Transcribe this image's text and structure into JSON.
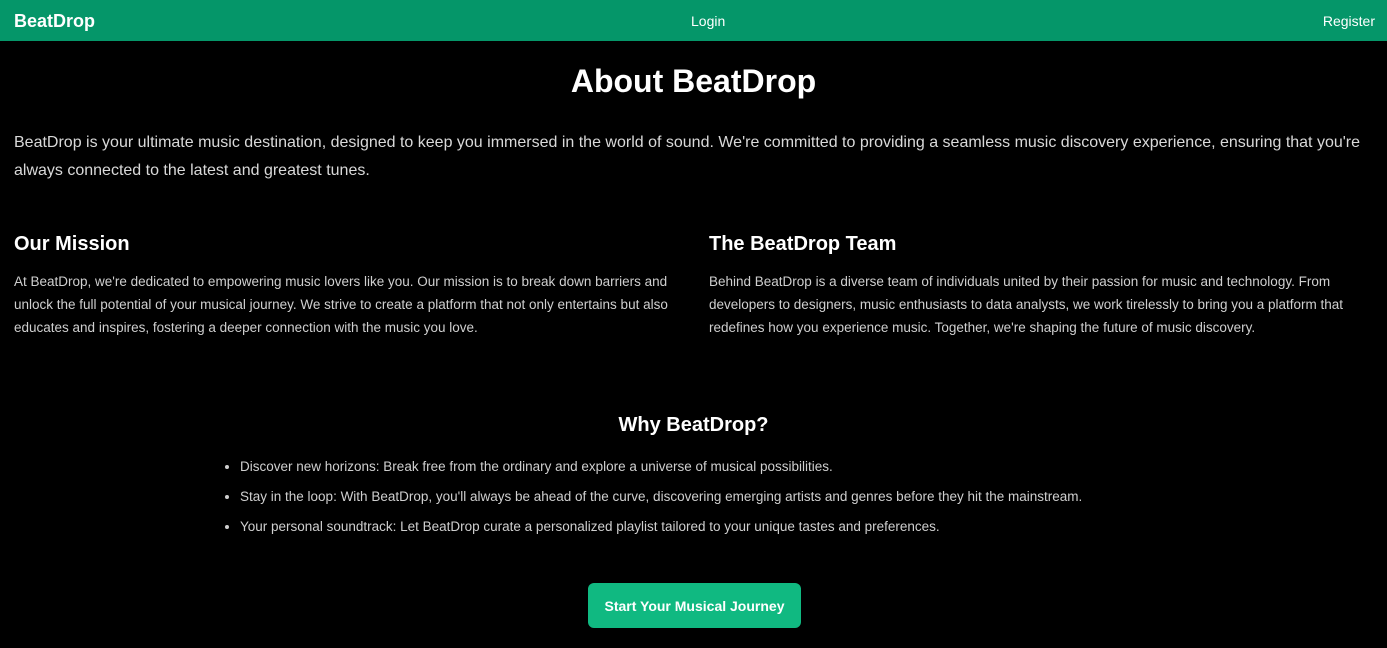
{
  "navbar": {
    "brand": "BeatDrop",
    "login_label": "Login",
    "register_label": "Register",
    "color": "#059669"
  },
  "about": {
    "title": "About BeatDrop",
    "intro": "BeatDrop is your ultimate music destination, designed to keep you immersed in the world of sound. We're committed to providing a seamless music discovery experience, ensuring that you're always connected to the latest and greatest tunes."
  },
  "mission": {
    "heading": "Our Mission",
    "body": "At BeatDrop, we're dedicated to empowering music lovers like you. Our mission is to break down barriers and unlock the full potential of your musical journey. We strive to create a platform that not only entertains but also educates and inspires, fostering a deeper connection with the music you love."
  },
  "team": {
    "heading": "The BeatDrop Team",
    "body": "Behind BeatDrop is a diverse team of individuals united by their passion for music and technology. From developers to designers, music enthusiasts to data analysts, we work tirelessly to bring you a platform that redefines how you experience music. Together, we're shaping the future of music discovery."
  },
  "why": {
    "heading": "Why BeatDrop?",
    "items": [
      "Discover new horizons: Break free from the ordinary and explore a universe of musical possibilities.",
      "Stay in the loop: With BeatDrop, you'll always be ahead of the curve, discovering emerging artists and genres before they hit the mainstream.",
      "Your personal soundtrack: Let BeatDrop curate a personalized playlist tailored to your unique tastes and preferences."
    ]
  },
  "cta": {
    "label": "Start Your Musical Journey",
    "color": "#10b981"
  }
}
